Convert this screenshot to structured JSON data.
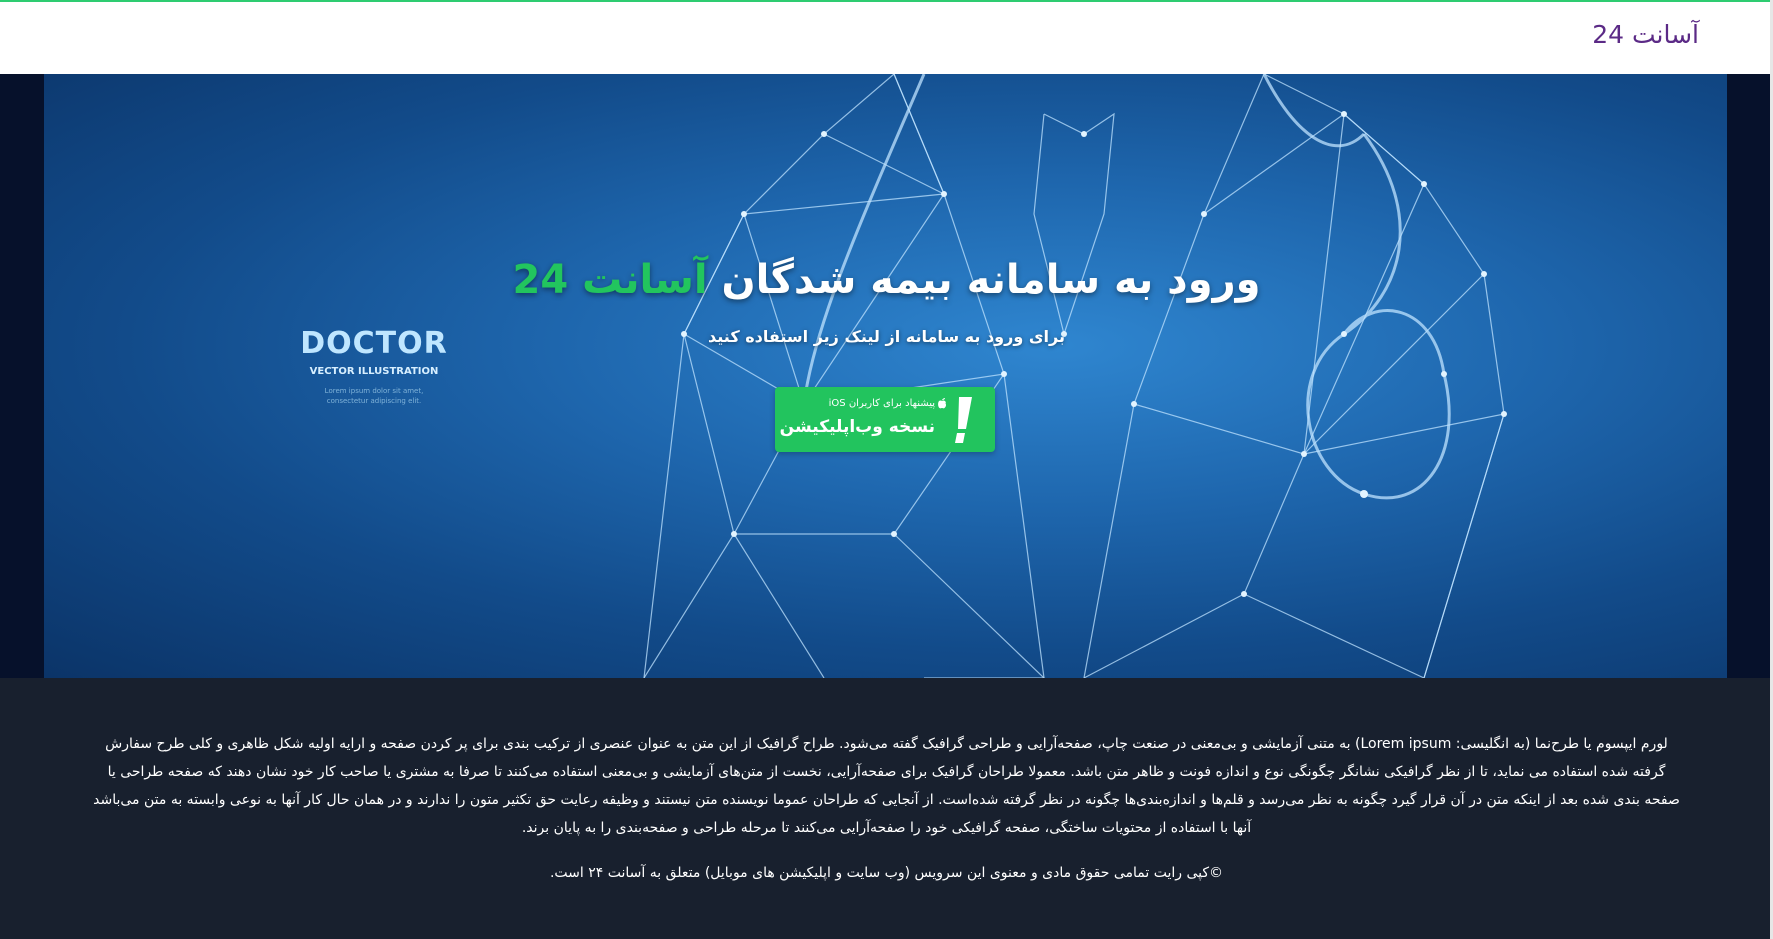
{
  "header": {
    "brand": "آسانت 24"
  },
  "hero": {
    "heading_prefix": "ورود به سامانه بیمه شدگان ",
    "heading_accent": "آسانت 24",
    "subtitle": "برای ورود به سامانه از لینک زیر استفاده کنید",
    "image_title": "DOCTOR",
    "image_subtitle": "VECTOR ILLUSTRATION",
    "image_caption_line1": "Lorem ipsum dolor sit amet,",
    "image_caption_line2": "consectetur adipiscing elit."
  },
  "webapp_button": {
    "small_label": "پیشنهاد برای کاربران iOS",
    "main_label": "نسخه وب‌اپلیکیشن",
    "icon": "exclamation-icon"
  },
  "footer": {
    "paragraph": "لورم ایپسوم یا طرح‌نما (به انگلیسی: Lorem ipsum) به متنی آزمایشی و بی‌معنی در صنعت چاپ، صفحه‌آرایی و طراحی گرافیک گفته می‌شود. طراح گرافیک از این متن به عنوان عنصری از ترکیب بندی برای پر کردن صفحه و ارایه اولیه شکل ظاهری و کلی طرح سفارش گرفته شده استفاده می نماید، تا از نظر گرافیکی نشانگر چگونگی نوع و اندازه فونت و ظاهر متن باشد. معمولا طراحان گرافیک برای صفحه‌آرایی، نخست از متن‌های آزمایشی و بی‌معنی استفاده می‌کنند تا صرفا به مشتری یا صاحب کار خود نشان دهند که صفحه طراحی یا صفحه بندی شده بعد از اینکه متن در آن قرار گیرد چگونه به نظر می‌رسد و قلم‌ها و اندازه‌بندی‌ها چگونه در نظر گرفته شده‌است. از آنجایی که طراحان عموما نویسنده متن نیستند و وظیفه رعایت حق تکثیر متون را ندارند و در همان حال کار آنها به نوعی وابسته به متن می‌باشد آنها با استفاده از محتویات ساختگی، صفحه گرافیکی خود را صفحه‌آرایی می‌کنند تا مرحله طراحی و صفحه‌بندی را به پایان برند.",
    "copyright": "©کپی رایت تمامی حقوق مادی و معنوی این سرویس (وب سایت و اپلیکیشن های موبایل) متعلق به آسانت ۲۴ است."
  },
  "colors": {
    "brand_purple": "#5b2a86",
    "accent_green": "#22c55e",
    "footer_bg": "#18202e",
    "hero_blue": "#1e66ad"
  }
}
